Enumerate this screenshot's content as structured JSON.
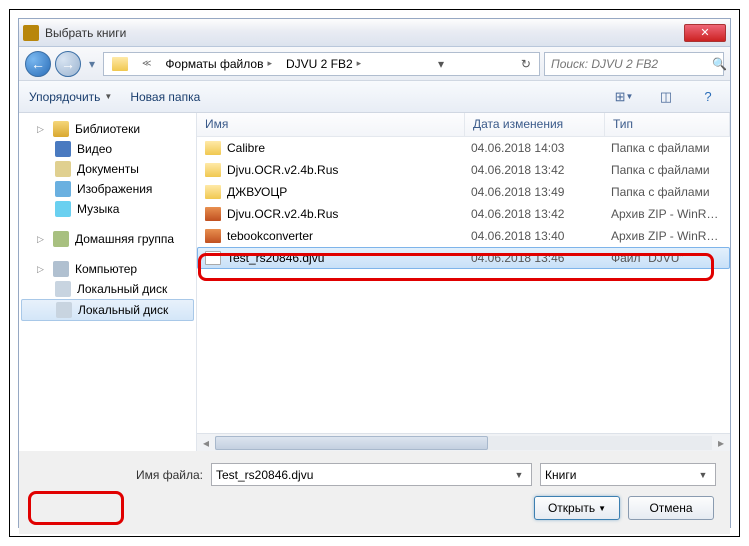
{
  "window": {
    "title": "Выбрать книги"
  },
  "nav": {
    "crumbs": [
      "Форматы файлов",
      "DJVU 2 FB2"
    ],
    "search_placeholder": "Поиск: DJVU 2 FB2"
  },
  "toolbar": {
    "organize": "Упорядочить",
    "newfolder": "Новая папка"
  },
  "sidebar": {
    "libraries": "Библиотеки",
    "video": "Видео",
    "documents": "Документы",
    "images": "Изображения",
    "music": "Музыка",
    "homegroup": "Домашняя группа",
    "computer": "Компьютер",
    "disk1": "Локальный диск",
    "disk2": "Локальный диск"
  },
  "columns": {
    "name": "Имя",
    "date": "Дата изменения",
    "type": "Тип"
  },
  "files": [
    {
      "name": "Calibre",
      "date": "04.06.2018 14:03",
      "type": "Папка с файлами",
      "icon": "folder"
    },
    {
      "name": "Djvu.OCR.v2.4b.Rus",
      "date": "04.06.2018 13:42",
      "type": "Папка с файлами",
      "icon": "folder"
    },
    {
      "name": "ДЖВУОЦР",
      "date": "04.06.2018 13:49",
      "type": "Папка с файлами",
      "icon": "folder"
    },
    {
      "name": "Djvu.OCR.v2.4b.Rus",
      "date": "04.06.2018 13:42",
      "type": "Архив ZIP - WinR…",
      "icon": "zip"
    },
    {
      "name": "tebookconverter",
      "date": "04.06.2018 13:40",
      "type": "Архив ZIP - WinR…",
      "icon": "zip"
    },
    {
      "name": "Test_rs20846.djvu",
      "date": "04.06.2018 13:46",
      "type": "Файл \"DJVU\"",
      "icon": "djvu",
      "selected": true
    }
  ],
  "footer": {
    "filename_label": "Имя файла:",
    "filename_value": "Test_rs20846.djvu",
    "filter": "Книги",
    "open": "Открыть",
    "cancel": "Отмена"
  }
}
